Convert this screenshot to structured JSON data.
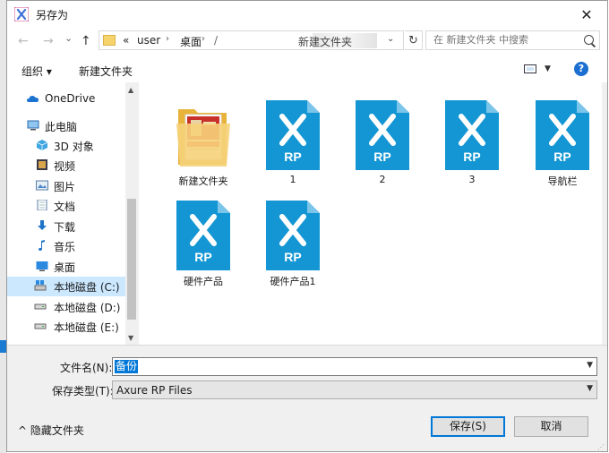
{
  "window": {
    "title": "另存为",
    "close_glyph": "✕"
  },
  "nav": {
    "back_glyph": "←",
    "forward_glyph": "→",
    "dropdown_glyph": "⌄",
    "up_glyph": "↑",
    "breadcrumb": {
      "overflow": "«",
      "user": "user",
      "desktop": "桌面",
      "partial": "/",
      "current": "新建文件夹"
    },
    "refresh_glyph": "↻",
    "search_placeholder": "在 新建文件夹 中搜索"
  },
  "toolbar": {
    "organize_label": "组织 ▾",
    "new_folder_label": "新建文件夹",
    "help_glyph": "?"
  },
  "sidebar": {
    "items": [
      {
        "label": "OneDrive",
        "icon": "onedrive-icon"
      },
      {
        "label": "此电脑",
        "icon": "this-pc-icon"
      },
      {
        "label": "3D 对象",
        "icon": "3d-objects-icon"
      },
      {
        "label": "视频",
        "icon": "video-icon"
      },
      {
        "label": "图片",
        "icon": "pictures-icon"
      },
      {
        "label": "文档",
        "icon": "documents-icon"
      },
      {
        "label": "下载",
        "icon": "downloads-icon"
      },
      {
        "label": "音乐",
        "icon": "music-icon"
      },
      {
        "label": "桌面",
        "icon": "desktop-icon"
      },
      {
        "label": "本地磁盘 (C:)",
        "icon": "drive-c-icon",
        "selected": true
      },
      {
        "label": "本地磁盘 (D:)",
        "icon": "drive-d-icon"
      },
      {
        "label": "本地磁盘 (E:)",
        "icon": "drive-e-icon"
      }
    ]
  },
  "files": [
    {
      "name": "新建文件夹",
      "type": "folder"
    },
    {
      "name": "1",
      "type": "rp",
      "icon_text": "RP"
    },
    {
      "name": "2",
      "type": "rp",
      "icon_text": "RP"
    },
    {
      "name": "3",
      "type": "rp",
      "icon_text": "RP"
    },
    {
      "name": "导航栏",
      "type": "rp",
      "icon_text": "RP"
    },
    {
      "name": "硬件产品",
      "type": "rp",
      "icon_text": "RP"
    },
    {
      "name": "硬件产品1",
      "type": "rp",
      "icon_text": "RP"
    }
  ],
  "save_form": {
    "filename_label": "文件名(N):",
    "filename_value": "备份",
    "filetype_label": "保存类型(T):",
    "filetype_value": "Axure RP Files",
    "hide_folders_label": "^ 隐藏文件夹",
    "save_button": "保存(S)",
    "cancel_button": "取消"
  },
  "colors": {
    "accent": "#0078d7",
    "rp_icon": "#1396d3",
    "selection": "#cce8ff"
  }
}
